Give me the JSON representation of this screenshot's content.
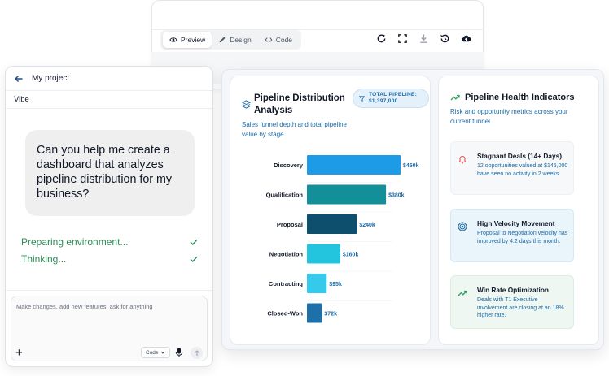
{
  "toolbar": {
    "tabs": [
      {
        "label": "Preview",
        "icon": "eye-icon",
        "active": true
      },
      {
        "label": "Design",
        "icon": "pencil-icon",
        "active": false
      },
      {
        "label": "Code",
        "icon": "code-icon",
        "active": false
      }
    ],
    "actions": [
      "refresh-icon",
      "fullscreen-icon",
      "download-icon",
      "history-icon",
      "cloud-upload-icon"
    ]
  },
  "chat": {
    "project_title": "My project",
    "subtitle": "Vibe",
    "message": "Can you help me create a dashboard that analyzes pipeline distribution for my business?",
    "status": [
      {
        "text": "Preparing environment...",
        "done": true
      },
      {
        "text": "Thinking...",
        "done": true
      }
    ],
    "input_placeholder": "Make changes, add new features, ask for anything",
    "mode_select": "Code"
  },
  "pipeline": {
    "title": "Pipeline Distribution Analysis",
    "badge": "TOTAL PIPELINE: $1,397,000",
    "badge_line1": "TOTAL PIPELINE:",
    "badge_line2": "$1,397,000",
    "subtitle": "Sales funnel depth and total pipeline value by stage"
  },
  "chart_data": {
    "type": "bar",
    "orientation": "horizontal",
    "categories": [
      "Discovery",
      "Qualification",
      "Proposal",
      "Negotiation",
      "Contracting",
      "Closed-Won"
    ],
    "values": [
      450,
      380,
      240,
      160,
      95,
      72
    ],
    "value_labels": [
      "$450k",
      "$380k",
      "$240k",
      "$160k",
      "$95k",
      "$72k"
    ],
    "unit": "$k",
    "colors": [
      "#1e9be6",
      "#138f9a",
      "#0e4f6e",
      "#22c5dd",
      "#35c9ec",
      "#1f6fa8"
    ],
    "title": "",
    "xlabel": "",
    "ylabel": "",
    "grid": false
  },
  "health": {
    "title": "Pipeline Health Indicators",
    "subtitle": "Risk and opportunity metrics across your current funnel",
    "indicators": [
      {
        "title": "Stagnant Deals (14+ Days)",
        "desc": "12 opportunities valued at $145,000 have seen no activity in 2 weeks.",
        "icon": "bell-icon",
        "color": "#e05252"
      },
      {
        "title": "High Velocity Movement",
        "desc": "Proposal to Negotiation velocity has improved by 4.2 days this month.",
        "icon": "target-icon",
        "color": "#1b6aa5"
      },
      {
        "title": "Win Rate Optimization",
        "desc": "Deals with T1 Executive involvement are closing at an 18% higher rate.",
        "icon": "trend-up-icon",
        "color": "#2e9e5e"
      }
    ]
  }
}
